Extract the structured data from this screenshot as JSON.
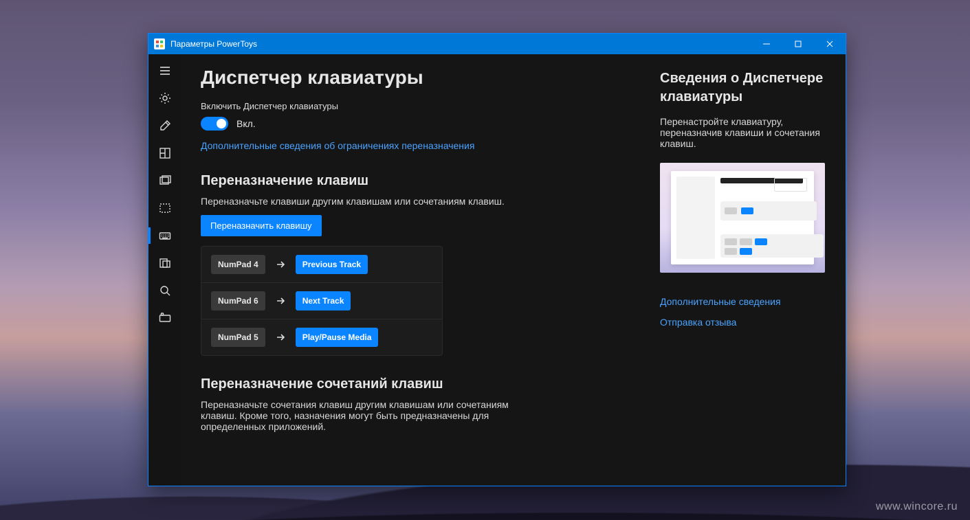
{
  "window": {
    "title": "Параметры PowerToys"
  },
  "sidebar": {
    "items": [
      {
        "name": "hamburger",
        "label": "Menu"
      },
      {
        "name": "general",
        "label": "General"
      },
      {
        "name": "color-picker",
        "label": "Color Picker"
      },
      {
        "name": "fancyzones",
        "label": "FancyZones"
      },
      {
        "name": "image-resizer",
        "label": "Image Resizer"
      },
      {
        "name": "file-explorer",
        "label": "File Explorer"
      },
      {
        "name": "keyboard-manager",
        "label": "Keyboard Manager",
        "active": true
      },
      {
        "name": "powertoys-run",
        "label": "PowerToys Run"
      },
      {
        "name": "power-rename",
        "label": "PowerRename"
      },
      {
        "name": "shortcut-guide",
        "label": "Shortcut Guide"
      }
    ]
  },
  "page": {
    "title": "Диспетчер клавиатуры",
    "enable_label": "Включить Диспетчер клавиатуры",
    "toggle_state": "Вкл.",
    "more_link": "Дополнительные сведения об ограничениях переназначения",
    "remap_keys_title": "Переназначение клавиш",
    "remap_keys_desc": "Переназначьте клавиши другим клавишам или сочетаниям клавиш.",
    "remap_key_button": "Переназначить клавишу",
    "remaps": [
      {
        "from": "NumPad 4",
        "to": "Previous Track"
      },
      {
        "from": "NumPad 6",
        "to": "Next Track"
      },
      {
        "from": "NumPad 5",
        "to": "Play/Pause Media"
      }
    ],
    "shortcut_title": "Переназначение сочетаний клавиш",
    "shortcut_desc": "Переназначьте сочетания клавиш другим клавишам или сочетаниям клавиш. Кроме того, назначения могут быть предназначены для определенных приложений."
  },
  "aside": {
    "title": "Сведения о Диспетчере клавиатуры",
    "desc": "Перенастройте клавиатуру, переназначив клавиши и сочетания клавиш.",
    "link_more": "Дополнительные сведения",
    "link_feedback": "Отправка отзыва"
  },
  "watermark": "www.wincore.ru"
}
